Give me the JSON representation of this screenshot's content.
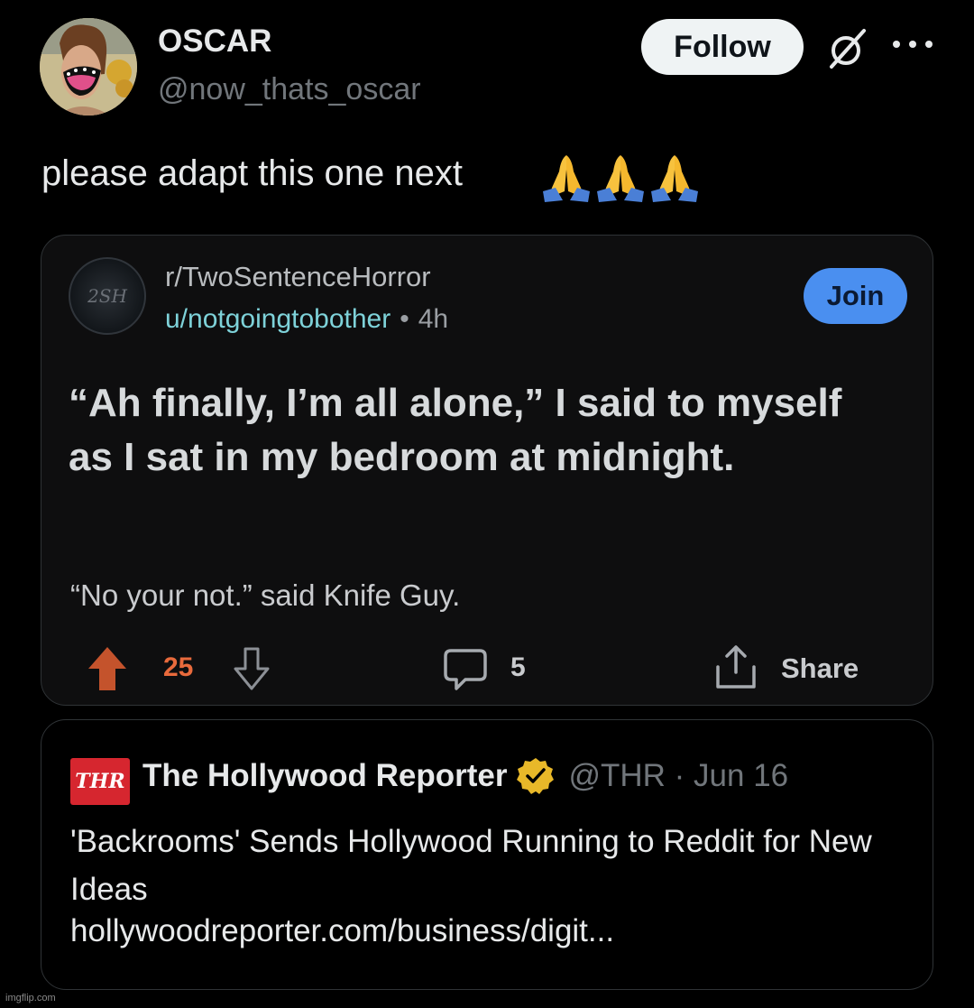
{
  "author": {
    "display_name": "OSCAR",
    "handle": "@now_thats_oscar",
    "follow_label": "Follow"
  },
  "tweet": {
    "text": "please adapt this one next",
    "emojis": [
      "folded-hands-emoji",
      "folded-hands-emoji",
      "folded-hands-emoji"
    ]
  },
  "reddit_post": {
    "subreddit": "r/TwoSentenceHorror",
    "subreddit_icon_text": "2SH",
    "username": "u/notgoingtobother",
    "separator": "•",
    "time_ago": "4h",
    "join_label": "Join",
    "title": "“Ah finally, I’m all alone,” I said to myself as I sat in my bedroom at midnight.",
    "body": "“No your not.” said Knife Guy.",
    "upvotes": "25",
    "comments": "5",
    "share_label": "Share",
    "upvote_color": "#e86a3c",
    "join_color": "#4a8ff0"
  },
  "quoted_tweet": {
    "logo_text": "THR",
    "name": "The Hollywood Reporter",
    "meta": "@THR · Jun 16",
    "text": "'Backrooms' Sends Hollywood Running to Reddit for New Ideas",
    "link": "hollywoodreporter.com/business/digit...",
    "verified_color": "#e8b829"
  },
  "watermark": "imgflip.com"
}
